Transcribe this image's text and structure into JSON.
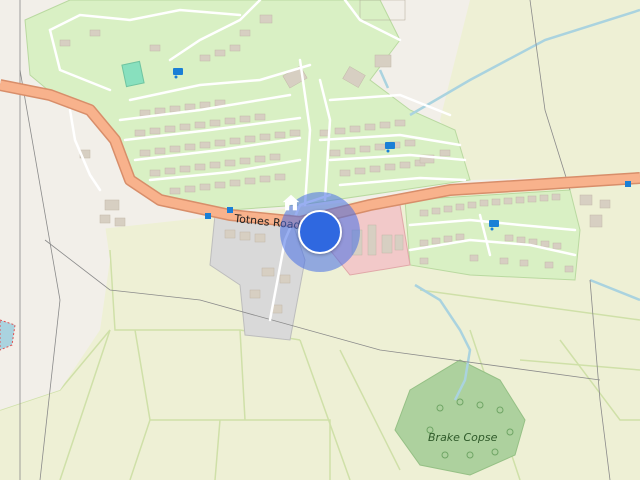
{
  "map": {
    "labels": {
      "road": "Totnes Road",
      "wood": "Brake Copse"
    },
    "marker": {
      "icon": "home-icon",
      "color": "#2f68e0",
      "halo_color": "#6b8df0"
    },
    "colors": {
      "background": "#f2efe9",
      "residential": "#d9f0c4",
      "residential_outline": "#b9d9a0",
      "farmland": "#eef0d5",
      "field_line": "#cfe0a8",
      "woodland": "#add19e",
      "road_fill": "#f8b28c",
      "road_casing": "#d88e6a",
      "water": "#aad3df",
      "commercial": "#f2c9c9",
      "industrial": "#d9d9d9",
      "building": "#d7cfc2"
    },
    "icons": [
      "caravan-icon",
      "bus-stop-icon",
      "home-icon"
    ]
  }
}
